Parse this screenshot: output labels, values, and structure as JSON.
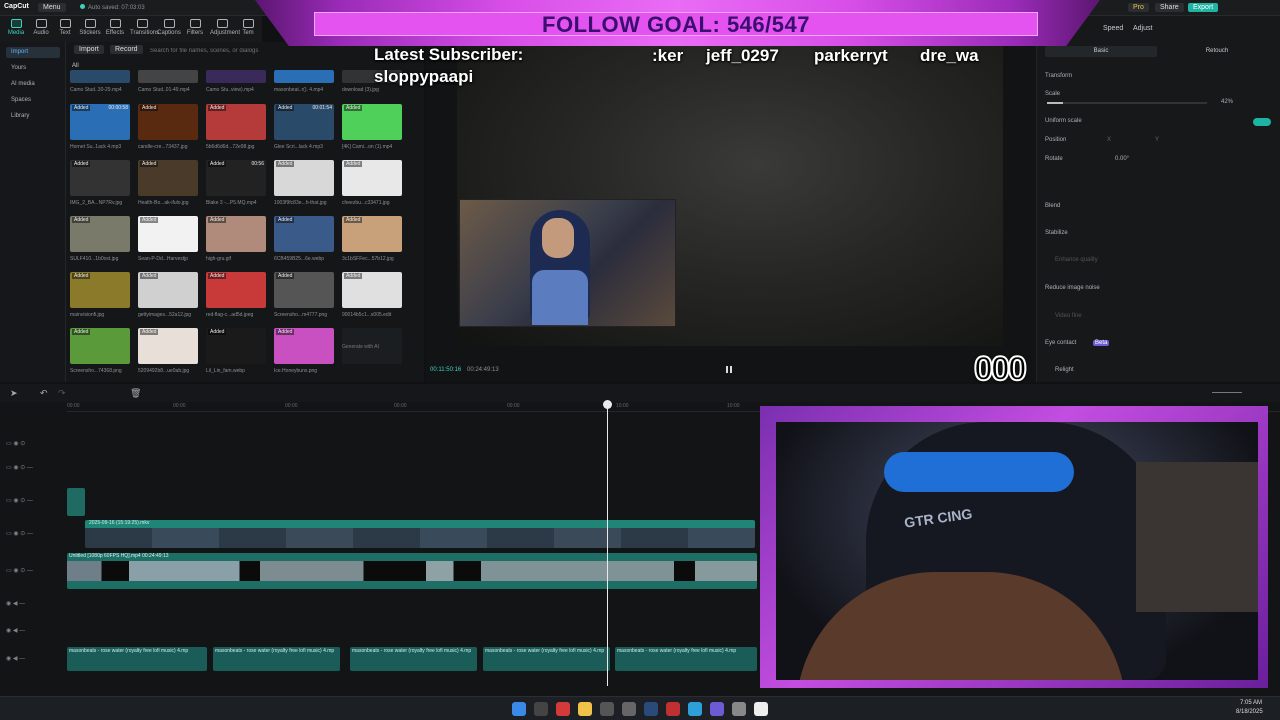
{
  "titlebar": {
    "app_name": "CapCut",
    "menu_label": "Menu",
    "autosave": "Auto saved: 07:03:03",
    "pro_label": "Pro",
    "share_label": "Share",
    "export_label": "Export"
  },
  "toolbar": {
    "items": [
      "Media",
      "Audio",
      "Text",
      "Stickers",
      "Effects",
      "Transitions",
      "Captions",
      "Filters",
      "Adjustment",
      "Tem"
    ]
  },
  "leftnav": {
    "items": [
      "Import",
      "Yours",
      "AI media",
      "Spaces",
      "Library"
    ]
  },
  "media": {
    "import_label": "Import",
    "record_label": "Record",
    "search_placeholder": "Search for file names, scenes, or dialogs",
    "all_label": "All",
    "top_row_labels": [
      "Camo Stud..30-29.mp4",
      "Camo Stud..01-49.mp4",
      "Camo Stu..view).mp4",
      "masonbeat..r(). 4.mp4",
      "download (3).jpg"
    ],
    "grid": [
      {
        "badge": "Added",
        "dur": "00:00:58",
        "label": "Hornet Su..1ack 4.mp3"
      },
      {
        "badge": "Added",
        "dur": "",
        "label": "candle-cre...73437.jpg"
      },
      {
        "badge": "Added",
        "dur": "",
        "label": "5b6d6d6d...72e98.jpg"
      },
      {
        "badge": "Added",
        "dur": "00:01:54",
        "label": "Glee Scri...lack 4.mp3"
      },
      {
        "badge": "Added",
        "dur": "",
        "label": "[4K] Cami...on (1).mp4"
      },
      {
        "badge": "Added",
        "dur": "",
        "label": "IMG_2_BA...NP7Rv.jpg"
      },
      {
        "badge": "Added",
        "dur": "",
        "label": "Health-Bo...ak-ifulo.jpg"
      },
      {
        "badge": "Added",
        "dur": "00:56",
        "label": "Blake 3 -...P5.MQ.mp4"
      },
      {
        "badge": "Added",
        "dur": "",
        "label": "1003f9fc83e...h-that.jpg"
      },
      {
        "badge": "Added",
        "dur": "",
        "label": "cheezbu...c33471.jpg"
      },
      {
        "badge": "Added",
        "dur": "",
        "label": "SULF410...1b0ost.jpg"
      },
      {
        "badge": "Added",
        "dur": "",
        "label": "Sean-P-Dd...Harvestjp"
      },
      {
        "badge": "Added",
        "dur": "",
        "label": "high-gru.gif"
      },
      {
        "badge": "Added",
        "dur": "",
        "label": "6CB459B25...6e.webp"
      },
      {
        "badge": "Added",
        "dur": "",
        "label": "3c1bSFFec...57b12.jpg"
      },
      {
        "badge": "Added",
        "dur": "",
        "label": "mainvisionfi.jpg"
      },
      {
        "badge": "Added",
        "dur": "",
        "label": "gettyimages...52a12.jpg"
      },
      {
        "badge": "Added",
        "dur": "",
        "label": "red-flag-c...ad5d.jpeg"
      },
      {
        "badge": "Added",
        "dur": "",
        "label": "Screensho...m4777.png"
      },
      {
        "badge": "Added",
        "dur": "",
        "label": "90014b5c1...s005.edit"
      },
      {
        "badge": "Added",
        "dur": "",
        "label": "Screensho...74368.png"
      },
      {
        "badge": "Added",
        "dur": "",
        "label": "5209492b8...ue0ab.jpg"
      },
      {
        "badge": "Added",
        "dur": "",
        "label": "Lil_Lin_fam.webp"
      },
      {
        "badge": "Added",
        "dur": "",
        "label": "Ice.Honeybuns.png"
      },
      {
        "badge": "",
        "dur": "",
        "label": "Generate with AI"
      }
    ]
  },
  "player": {
    "time_current": "00:11:50:16",
    "time_total": "00:24:49:13"
  },
  "rightpanel": {
    "tabs": [
      "Speed",
      "Adjust"
    ],
    "subtabs": [
      "Basic",
      "Retouch"
    ],
    "transform_label": "Transform",
    "scale_label": "Scale",
    "scale_value": "42%",
    "uniform_scale_label": "Uniform scale",
    "position_label": "Position",
    "pos_x_label": "X",
    "pos_y_label": "Y",
    "rotate_label": "Rotate",
    "rotate_value": "0.00°",
    "blend_label": "Blend",
    "stabilize_label": "Stabilize",
    "stabilize_sub": "Enhance quality",
    "noise_label": "Reduce image noise",
    "noise_sub": "Video fine",
    "eye_contact_label": "Eye contact",
    "eye_contact_badge": "Beta",
    "relight_label": "Relight"
  },
  "timeline": {
    "ruler_labels": [
      "00:00",
      "00:00",
      "00:00",
      "00:00",
      "00:00",
      "10:00",
      "10:00"
    ],
    "video_track_label": "Untitled [1080p 60FPS HQ].mp4  00:24:49:13",
    "audio_clip_label": "masonbeats - rose water (royalty free lofi music) 4.mp",
    "frames_label": "2025-09-16 (15:19:25).mkv"
  },
  "overlay": {
    "follow_goal": "FOLLOW GOAL: 546/547",
    "subscriber_label": "Latest Subscriber:",
    "subscriber_name": "sloppypaapi",
    "ticker": [
      ":ker",
      "jeff_0297",
      "parkerryt",
      "dre_wa"
    ],
    "counter": "000",
    "cam_chair_text": "GTR CING"
  },
  "taskbar": {
    "time": "7:05 AM",
    "date": "8/18/2025"
  }
}
